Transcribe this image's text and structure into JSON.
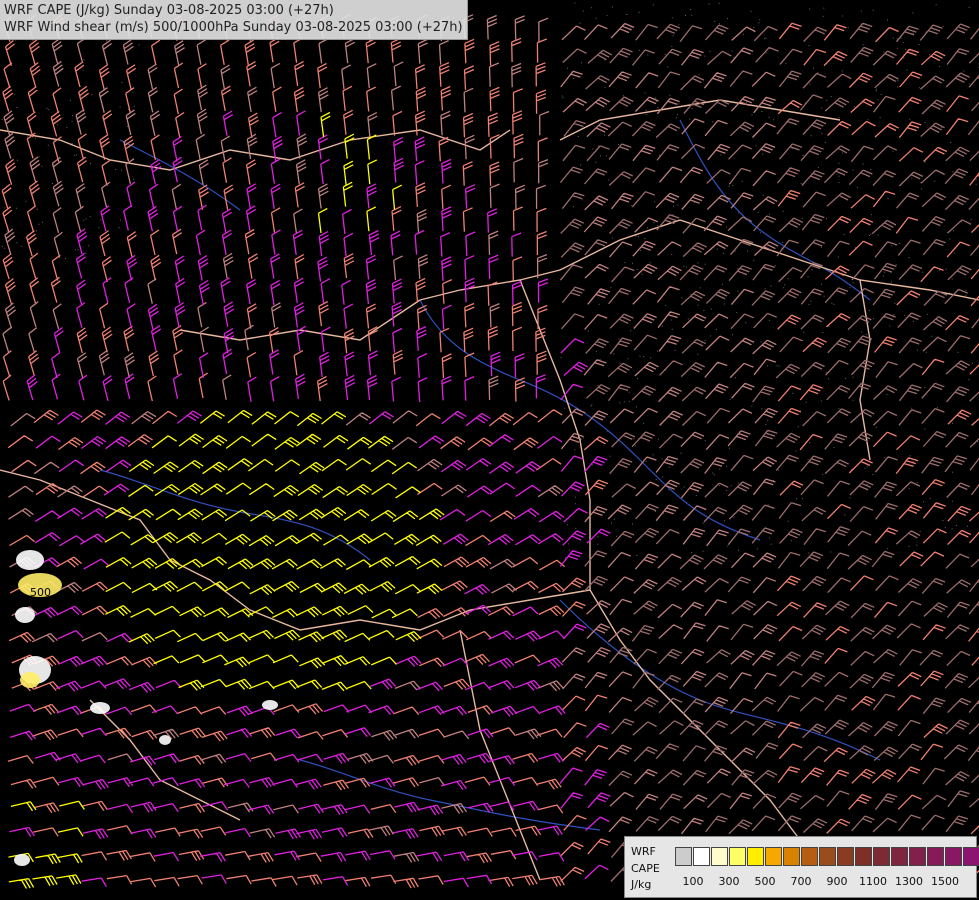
{
  "title": {
    "line1": "WRF CAPE (J/kg) Sunday 03-08-2025 03:00 (+27h)",
    "line2": "WRF Wind shear (m/s) 500/1000hPa Sunday 03-08-2025 03:00 (+27h)"
  },
  "map_label": "500",
  "legend": {
    "model": "WRF",
    "variable": "CAPE",
    "unit": "J/kg",
    "colors": [
      "#ffffff",
      "#fffccc",
      "#ffff66",
      "#ffee00",
      "#f7a800",
      "#d98200",
      "#b55e12",
      "#9a4c1c",
      "#8a3c22",
      "#7e3028",
      "#7c2a34",
      "#7f2540",
      "#82204c",
      "#851c58",
      "#881864",
      "#8c1470",
      "#8f107c"
    ],
    "ticks": [
      "100",
      "300",
      "500",
      "700",
      "900",
      "1100",
      "1300",
      "1500"
    ]
  },
  "colors": {
    "barb_yellow": "#ffff00",
    "barb_magenta": "#e020e0",
    "barb_salmon": "#f08070",
    "barb_pinkbrown": "#c08080",
    "barb_brown": "#9c6c6c",
    "border": "#e6b8a0",
    "river": "#3050c0",
    "background": "#000000"
  }
}
